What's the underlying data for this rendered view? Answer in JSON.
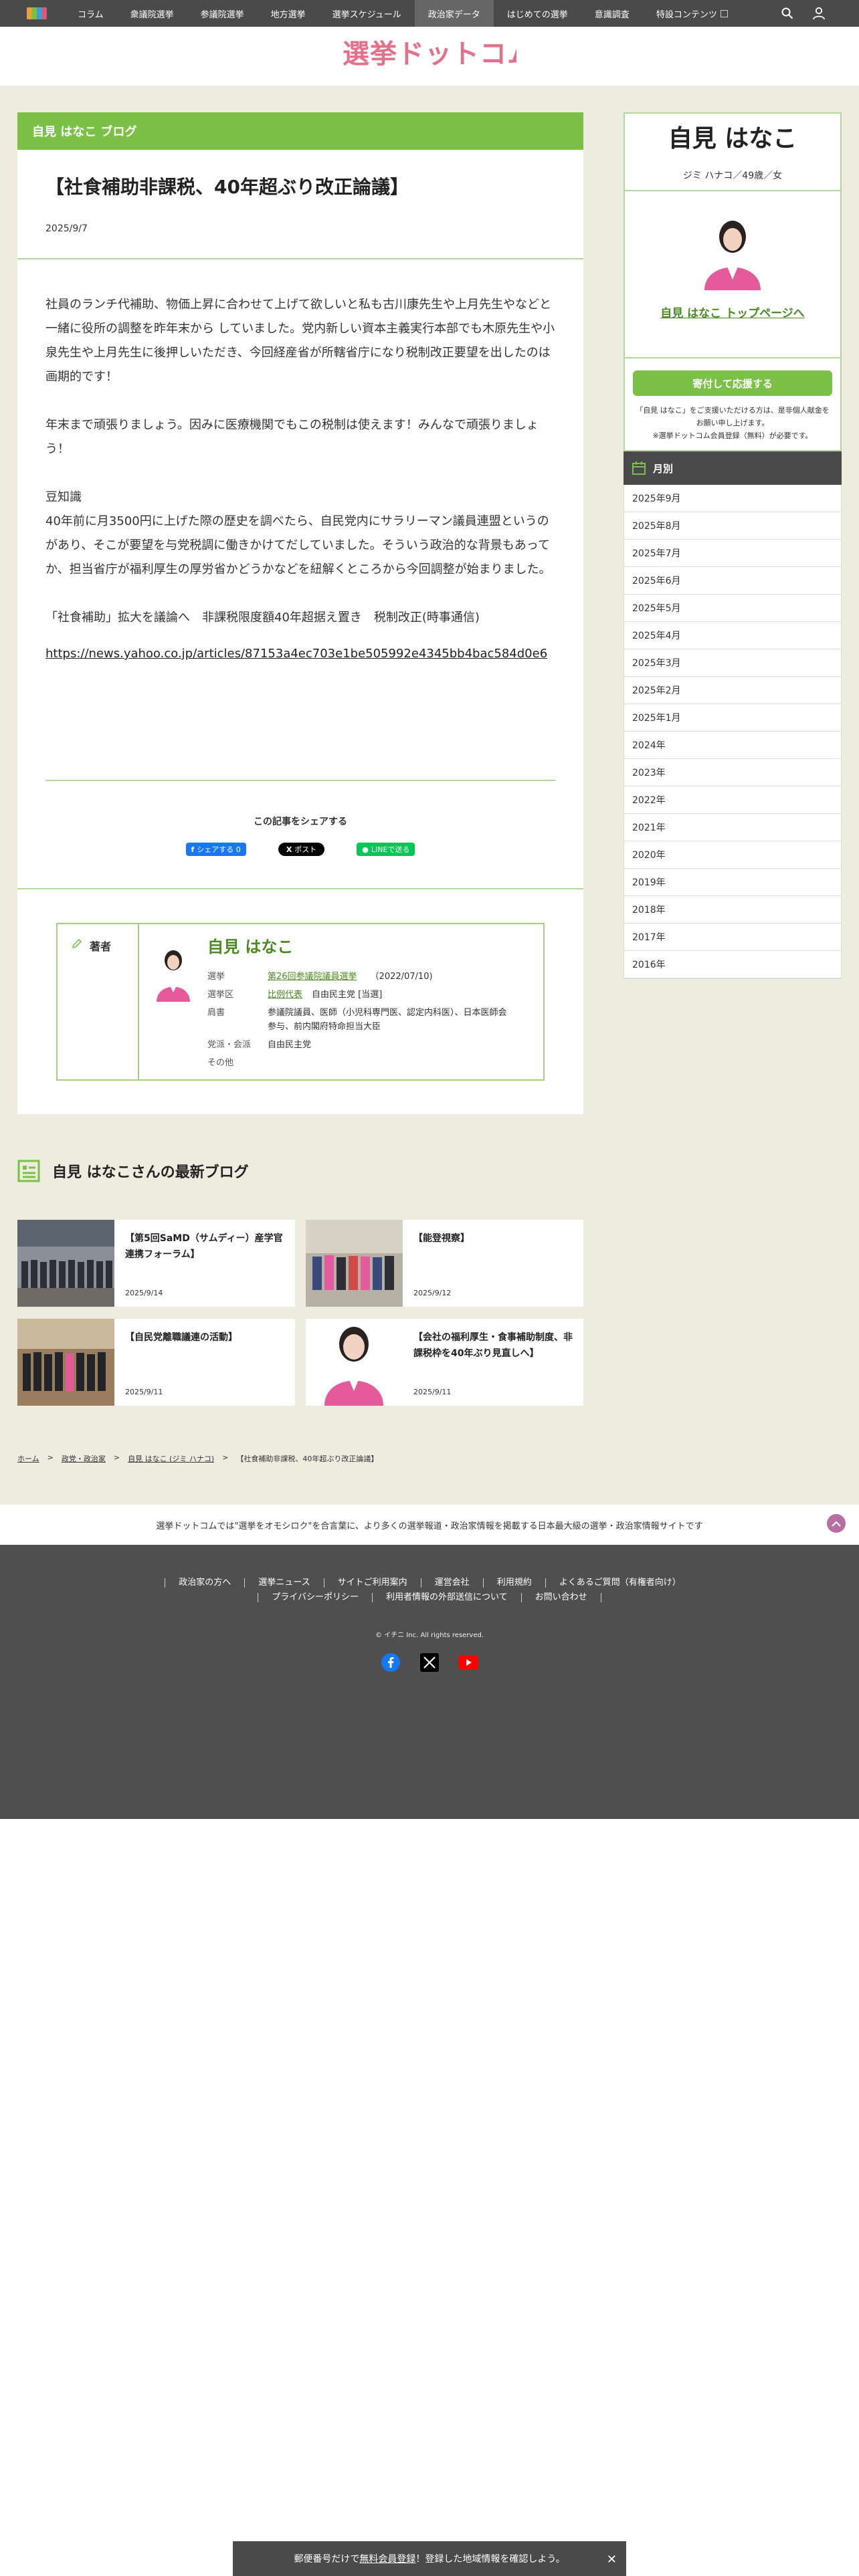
{
  "nav": {
    "items": [
      "コラム",
      "衆議院選挙",
      "参議院選挙",
      "地方選挙",
      "選挙スケジュール",
      "政治家データ",
      "はじめての選挙",
      "意識調査",
      "特設コンテンツ"
    ],
    "active_index": 5
  },
  "site": {
    "logo": "選挙ドットコム"
  },
  "article": {
    "blog_header": "自見 はなこ ブログ",
    "title": "【社食補助非課税、40年超ぶり改正論議】",
    "date": "2025/9/7",
    "paragraphs": [
      "社員のランチ代補助、物価上昇に合わせて上げて欲しいと私も古川康先生や上月先生やなどと一緒に役所の調整を昨年末から していました。党内新しい資本主義実行本部でも木原先生や小泉先生や上月先生に後押しいただき、今回経産省が所轄省庁になり税制改正要望を出したのは画期的です！",
      "年末まで頑張りましょう。因みに医療機関でもこの税制は使えます！みんなで頑張りましょう！",
      "豆知識\n40年前に月3500円に上げた際の歴史を調べたら、自民党内にサラリーマン議員連盟というのがあり、そこが要望を与党税調に働きかけてだしていました。そういう政治的な背景もあってか、担当省庁が福利厚生の厚労省かどうかなどを紐解くところから今回調整が始まりました。",
      "「社食補助」拡大を議論へ　非課税限度額40年超据え置き　税制改正(時事通信)"
    ],
    "link": "https://news.yahoo.co.jp/articles/87153a4ec703e1be505992e4345bb4bac584d0e6"
  },
  "share": {
    "title": "この記事をシェアする",
    "fb": "シェアする 0",
    "x": "ポスト",
    "line": "LINEで送る"
  },
  "author": {
    "label": "著者",
    "name": "自見 はなこ",
    "rows": [
      {
        "k": "選挙",
        "v": "第26回参議院議員選挙",
        "extra": "（2022/07/10)",
        "link": true
      },
      {
        "k": "選挙区",
        "v": "比例代表",
        "extra": "自由民主党 [当選]",
        "link": true
      },
      {
        "k": "肩書",
        "v": "参議院議員、医師（小児科専門医、認定内科医）、日本医師会参与、前内閣府特命担当大臣",
        "extra": "",
        "link": false
      },
      {
        "k": "党派・会派",
        "v": "自由民主党",
        "extra": "",
        "link": false
      },
      {
        "k": "その他",
        "v": "",
        "extra": "",
        "link": false
      }
    ]
  },
  "latest": {
    "title": "自見 はなこさんの最新ブログ",
    "cards": [
      {
        "title": "【第5回SaMD（サムディー）産学官連携フォーラム】",
        "date": "2025/9/14"
      },
      {
        "title": "【能登視察】",
        "date": "2025/9/12"
      },
      {
        "title": "【自民党離職議連の活動】",
        "date": "2025/9/11"
      },
      {
        "title": "【会社の福利厚生・食事補助制度、非課税枠を40年ぶり見直しへ】",
        "date": "2025/9/11"
      }
    ]
  },
  "breadcrumb": [
    "ホーム",
    "政党・政治家",
    "自見 はなこ (ジミ ハナコ)",
    "【社食補助非課税、40年超ぶり改正論議】"
  ],
  "profile": {
    "name": "自見 はなこ",
    "kana": "ジミ ハナコ／49歳／女",
    "top_link": "自見 はなこ トップページへ",
    "donate_button": "寄付して応援する",
    "donate_note": "「自見 はなこ」をご支援いただける方は、是非個人献金をお願い申し上げます。\n※選挙ドットコム会員登録（無料）が必要です。"
  },
  "months": {
    "title": "月別",
    "items": [
      "2025年9月",
      "2025年8月",
      "2025年7月",
      "2025年6月",
      "2025年5月",
      "2025年4月",
      "2025年3月",
      "2025年2月",
      "2025年1月",
      "2024年",
      "2023年",
      "2022年",
      "2021年",
      "2020年",
      "2019年",
      "2018年",
      "2017年",
      "2016年"
    ]
  },
  "footer": {
    "message": "選挙ドットコムでは\"選挙をオモシロク\"を合言葉に、より多くの選挙報道・政治家情報を掲載する日本最大級の選挙・政治家情報サイトです",
    "links": [
      "政治家の方へ",
      "選挙ニュース",
      "サイトご利用案内",
      "運営会社",
      "利用規約",
      "よくあるご質問（有権者向け）",
      "プライバシーポリシー",
      "利用者情報の外部送信について",
      "お問い合わせ"
    ],
    "copyright": "© イチニ Inc. All rights reserved."
  },
  "banner": {
    "text_pre": "郵便番号だけで",
    "text_link": "無料会員登録",
    "text_post": "！登録した地域情報を確認しよう。"
  },
  "colors": {
    "green": "#7cc147",
    "dark": "#4a4a4a",
    "beige": "#eeecdf",
    "pink": "#e45a9b"
  }
}
